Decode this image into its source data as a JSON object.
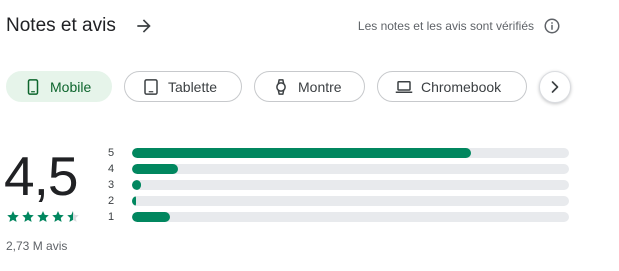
{
  "header": {
    "title": "Notes et avis",
    "verified_text": "Les notes et les avis sont vérifiés"
  },
  "chips": [
    {
      "label": "Mobile",
      "icon": "phone-icon",
      "selected": true
    },
    {
      "label": "Tablette",
      "icon": "tablet-icon",
      "selected": false
    },
    {
      "label": "Montre",
      "icon": "watch-icon",
      "selected": false
    },
    {
      "label": "Chromebook",
      "icon": "laptop-icon",
      "selected": false
    }
  ],
  "rating": {
    "score": "4,5",
    "stars": 4.5,
    "review_count": "2,73 M avis"
  },
  "distribution": [
    {
      "stars": "5",
      "fraction": 0.775
    },
    {
      "stars": "4",
      "fraction": 0.105
    },
    {
      "stars": "3",
      "fraction": 0.02
    },
    {
      "stars": "2",
      "fraction": 0.01
    },
    {
      "stars": "1",
      "fraction": 0.088
    }
  ],
  "colors": {
    "accent": "#01875f",
    "chip_selected_bg": "#e6f4ea",
    "chip_selected_text": "#0d652d",
    "track": "#e8eaed"
  }
}
